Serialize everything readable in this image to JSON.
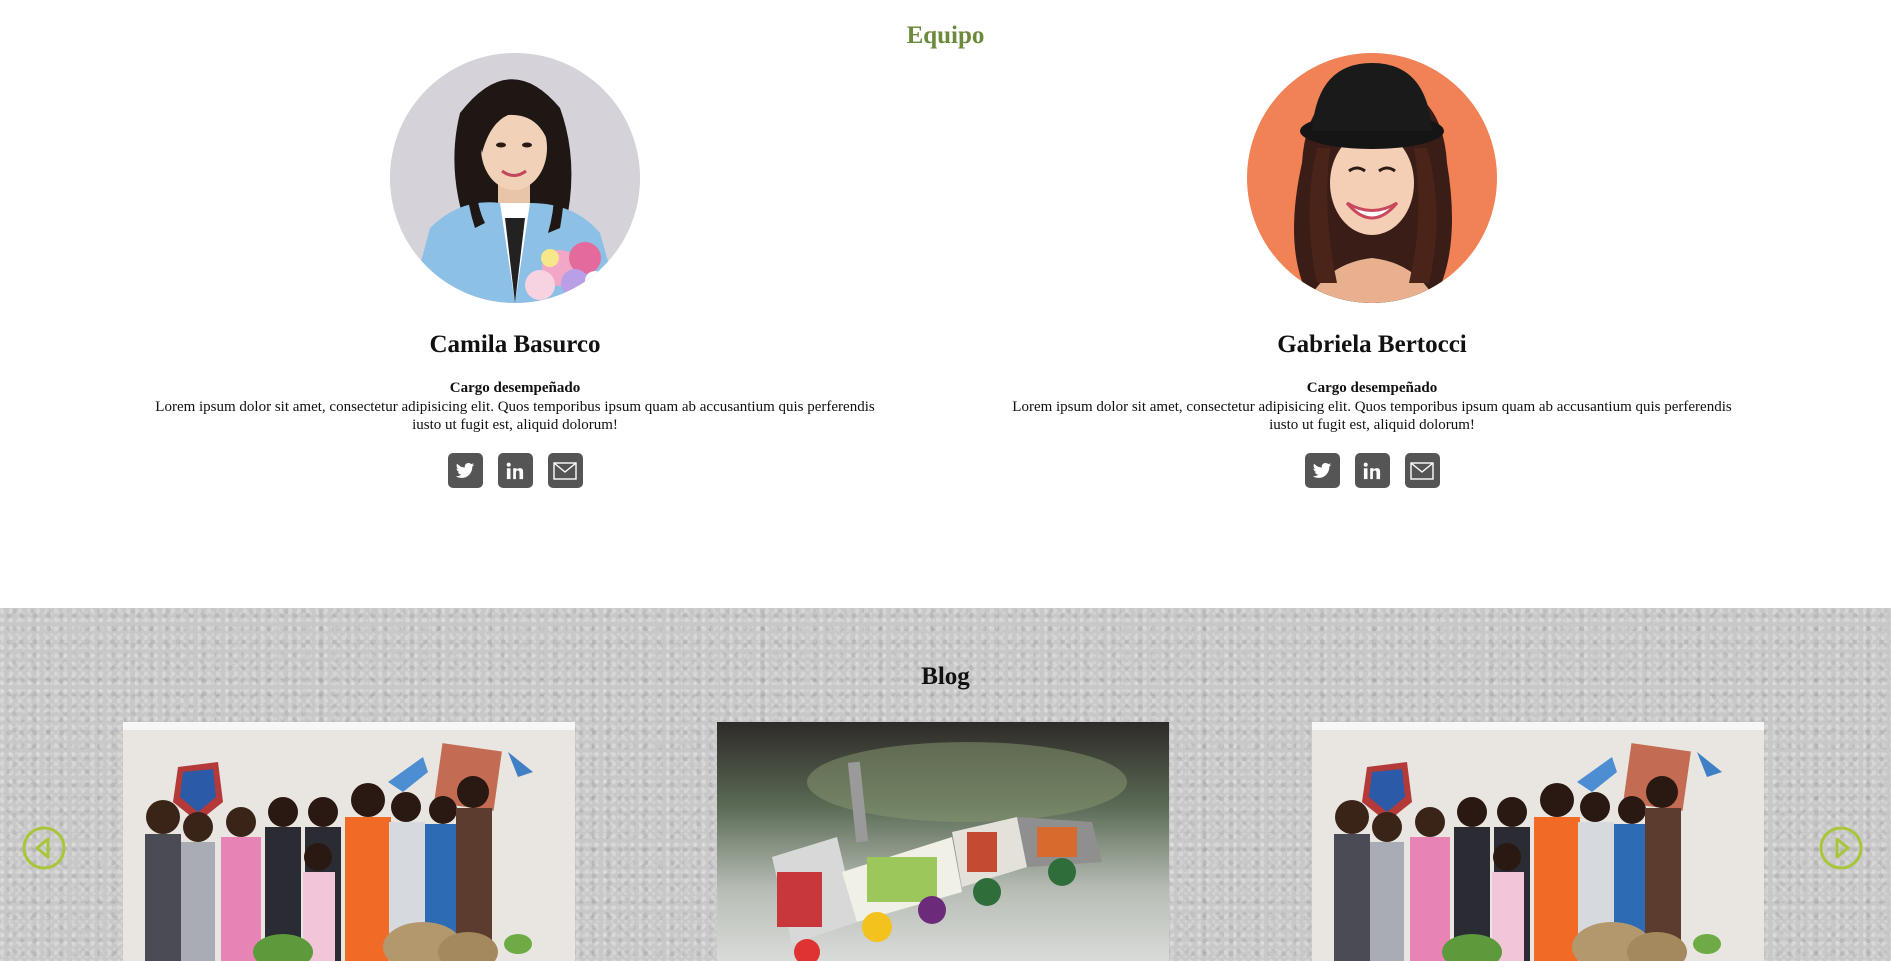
{
  "team": {
    "title": "Equipo",
    "members": [
      {
        "name": "Camila Basurco",
        "role": "Cargo desempeñado",
        "bio": "Lorem ipsum dolor sit amet, consectetur adipisicing elit. Quos temporibus ipsum quam ab accusantium quis perferendis iusto ut fugit est, aliquid dolorum!",
        "socials": [
          "twitter-icon",
          "linkedin-icon",
          "mail-icon"
        ]
      },
      {
        "name": "Gabriela Bertocci",
        "role": "Cargo desempeñado",
        "bio": "Lorem ipsum dolor sit amet, consectetur adipisicing elit. Quos temporibus ipsum quam ab accusantium quis perferendis iusto ut fugit est, aliquid dolorum!",
        "socials": [
          "twitter-icon",
          "linkedin-icon",
          "mail-icon"
        ]
      }
    ]
  },
  "blog": {
    "title": "Blog",
    "cards": [
      "group-photo",
      "recycled-toy-train-photo",
      "group-photo"
    ],
    "nav": [
      "previous-arrow-icon",
      "next-arrow-icon"
    ]
  },
  "colors": {
    "team_title": "#6b8a3c",
    "social_button": "#555555",
    "blog_background": "#c8c8c8",
    "arrow_accent": "#a8c63a"
  }
}
